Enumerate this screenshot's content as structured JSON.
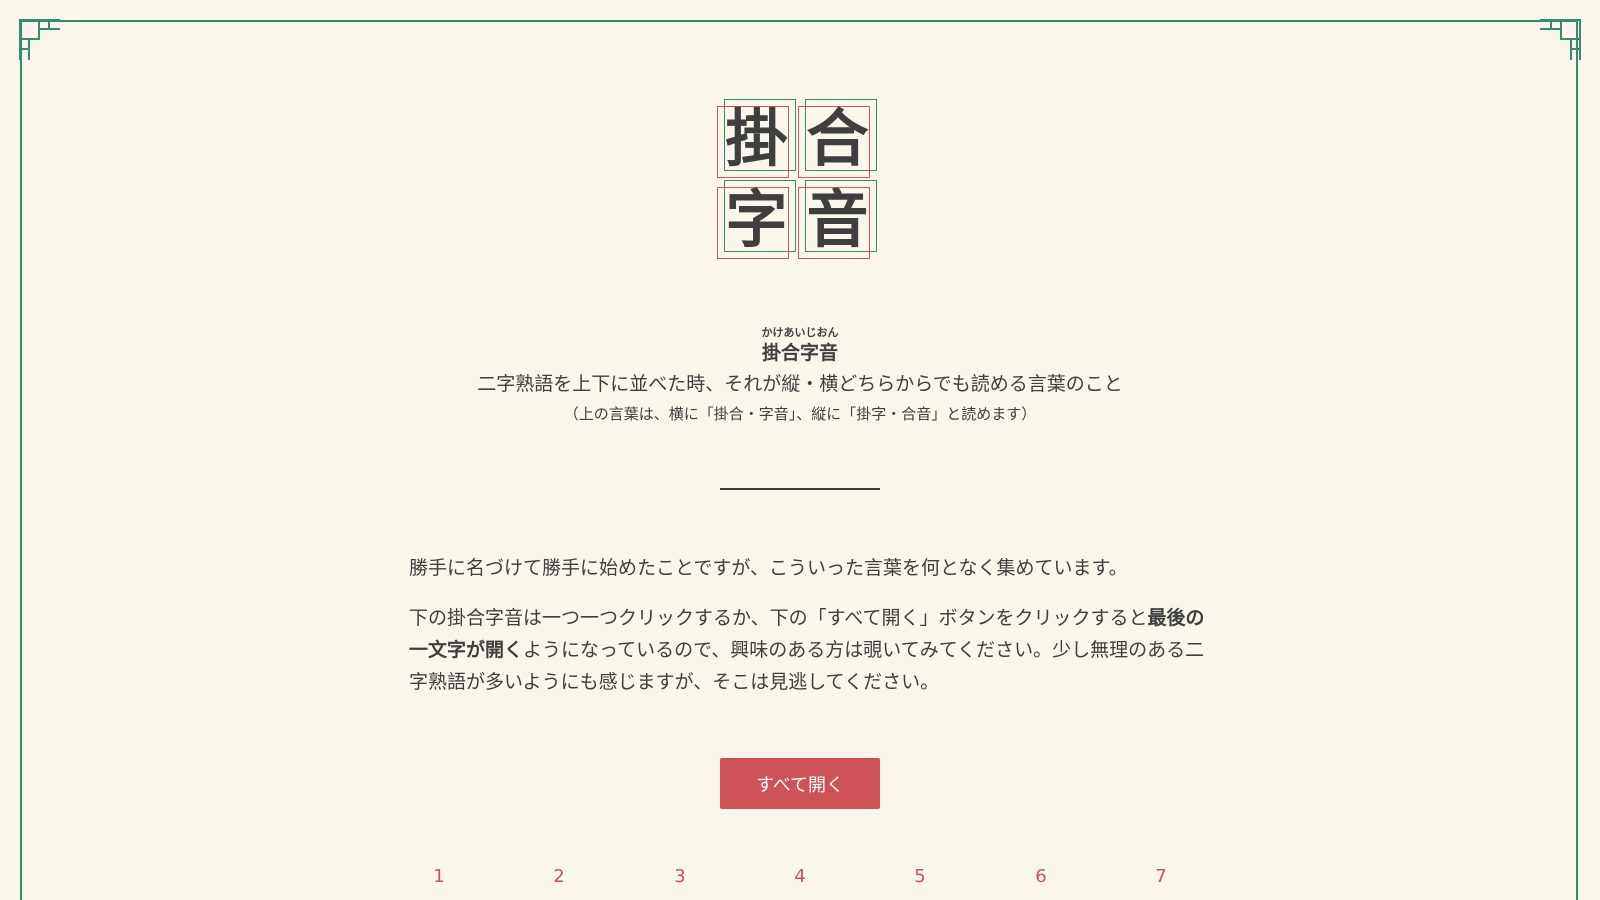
{
  "logo": {
    "chars": [
      "掛",
      "合",
      "字",
      "音"
    ]
  },
  "heading": {
    "ruby": "かけあいじおん",
    "title": "掛合字音",
    "definition": "二字熟語を上下に並べた時、それが縦・横どちらからでも読める言葉のこと",
    "note": "（上の言葉は、横に「掛合・字音」、縦に「掛字・合音」と読めます）"
  },
  "intro": {
    "p1": "勝手に名づけて勝手に始めたことですが、こういった言葉を何となく集めています。",
    "p2_before": "下の掛合字音は一つ一つクリックするか、下の「すべて開く」ボタンをクリックすると",
    "p2_bold": "最後の一文字が開く",
    "p2_after": "ようになっているので、興味のある方は覗いてみてください。少し無理のある二字熟語が多いようにも感じますが、そこは見逃してください。"
  },
  "button": {
    "open_all": "すべて開く"
  },
  "numbers": [
    "1",
    "2",
    "3",
    "4",
    "5",
    "6",
    "7"
  ],
  "colors": {
    "background": "#faf6ec",
    "green": "#3a8c68",
    "red": "#cf5356",
    "text": "#3f3f3f"
  }
}
